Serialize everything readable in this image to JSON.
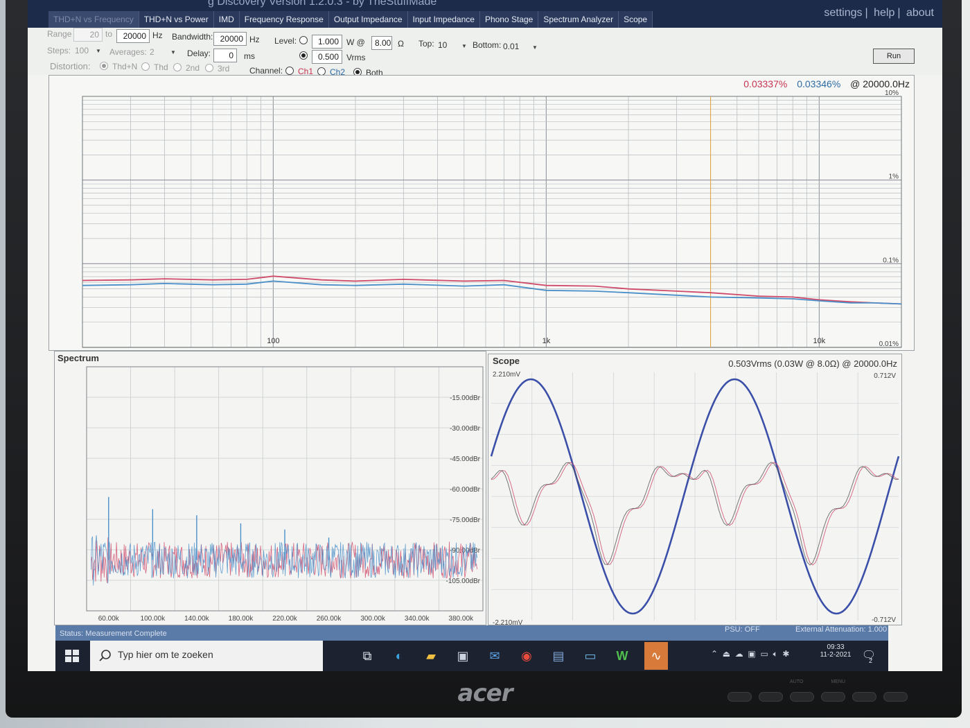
{
  "window": {
    "title": "g Discovery Version 1.2.0.3 - by TheStuffMade",
    "links": [
      "settings",
      "help",
      "about"
    ]
  },
  "tabs": [
    "THD+N vs Frequency",
    "THD+N vs Power",
    "IMD",
    "Frequency Response",
    "Output Impedance",
    "Input Impedance",
    "Phono Stage",
    "Spectrum Analyzer",
    "Scope"
  ],
  "controls": {
    "range_label": "Range",
    "range_from": "20",
    "to_label": "to",
    "range_to": "20000",
    "hz_label": "Hz",
    "steps_label": "Steps:",
    "steps_value": "100",
    "averages_label": "Averages:",
    "averages_value": "2",
    "distortion_label": "Distortion:",
    "distortion_options": [
      "Thd+N",
      "Thd",
      "2nd",
      "3rd"
    ],
    "bandwidth_label": "Bandwidth:",
    "bandwidth_value": "20000",
    "delay_label": "Delay:",
    "delay_value": "0",
    "ms_label": "ms",
    "level_label": "Level:",
    "level_watts": "1.000",
    "w_at_label": "W @",
    "load_value": "8.00",
    "ohm_label": "Ω",
    "level_vrms": "0.500",
    "vrms_label": "Vrms",
    "channel_label": "Channel:",
    "channel_options": [
      "Ch1",
      "Ch2",
      "Both"
    ],
    "top_label": "Top:",
    "top_value": "10",
    "bottom_label": "Bottom:",
    "bottom_value": "0.01",
    "run_label": "Run"
  },
  "thd_readout": {
    "ch1": "0.03337%",
    "ch2": "0.03346%",
    "freq": "@ 20000.0Hz"
  },
  "colors": {
    "ch1": "#d04a6a",
    "ch2": "#4b8fc9",
    "scope_trace": "#3b4fa8",
    "cursor": "#e0a23a"
  },
  "chart_data": [
    {
      "type": "line",
      "title": "",
      "x_scale": "log",
      "y_scale": "log",
      "xlim": [
        20,
        20000
      ],
      "ylim": [
        0.01,
        10
      ],
      "x_ticks": [
        "100",
        "1k",
        "10k"
      ],
      "y_ticks": [
        "10%",
        "1%",
        "0.1%",
        "0.01%"
      ],
      "grid": true,
      "x": [
        20,
        30,
        40,
        60,
        80,
        100,
        150,
        200,
        300,
        500,
        700,
        1000,
        1500,
        2000,
        3000,
        4000,
        6000,
        8000,
        10000,
        13000,
        16000,
        20000
      ],
      "series": [
        {
          "name": "Ch1",
          "values": [
            0.063,
            0.064,
            0.066,
            0.064,
            0.065,
            0.071,
            0.064,
            0.062,
            0.065,
            0.062,
            0.063,
            0.055,
            0.054,
            0.05,
            0.047,
            0.045,
            0.041,
            0.04,
            0.037,
            0.035,
            0.034,
            0.033
          ]
        },
        {
          "name": "Ch2",
          "values": [
            0.055,
            0.056,
            0.058,
            0.056,
            0.057,
            0.062,
            0.056,
            0.055,
            0.057,
            0.054,
            0.056,
            0.048,
            0.047,
            0.045,
            0.042,
            0.04,
            0.039,
            0.038,
            0.036,
            0.034,
            0.034,
            0.033
          ]
        }
      ]
    },
    {
      "type": "line",
      "title": "Spectrum",
      "x_ticks": [
        "60.00k",
        "100.00k",
        "140.00k",
        "180.00k",
        "220.00k",
        "260.00k",
        "300.00k",
        "340.00k",
        "380.00k"
      ],
      "y_ticks": [
        "-15.00dBr",
        "-30.00dBr",
        "-45.00dBr",
        "-60.00dBr",
        "-75.00dBr",
        "-90.00dBr",
        "-105.00dBr"
      ],
      "ylim": [
        -120,
        0
      ],
      "grid": true,
      "peaks_x": [
        60000,
        100000,
        140000,
        180000,
        220000,
        260000
      ],
      "peaks_y": [
        -64,
        -70,
        -73,
        -77,
        -80,
        -84
      ],
      "noise_floor": -95,
      "series": [
        {
          "name": "Ch1"
        },
        {
          "name": "Ch2"
        }
      ]
    },
    {
      "type": "line",
      "title": "Scope",
      "subtitle": "0.503Vrms (0.03W @ 8.0Ω) @ 20000.0Hz",
      "left_top": "2.210mV",
      "left_bottom": "-2.210mV",
      "right_top": "0.712V",
      "right_bottom": "-0.712V",
      "grid": true,
      "cycles": 2.0
    }
  ],
  "status": {
    "text": "Status: Measurement Complete",
    "psu": "PSU: OFF",
    "attenuation": "External Attenuation: 1.000"
  },
  "taskbar": {
    "search_placeholder": "Typ hier om te zoeken",
    "time": "09:33",
    "date": "11-2-2021",
    "notification_count": "2"
  },
  "monitor": {
    "brand": "acer",
    "button_labels": [
      "AUTO",
      "MENU"
    ]
  }
}
